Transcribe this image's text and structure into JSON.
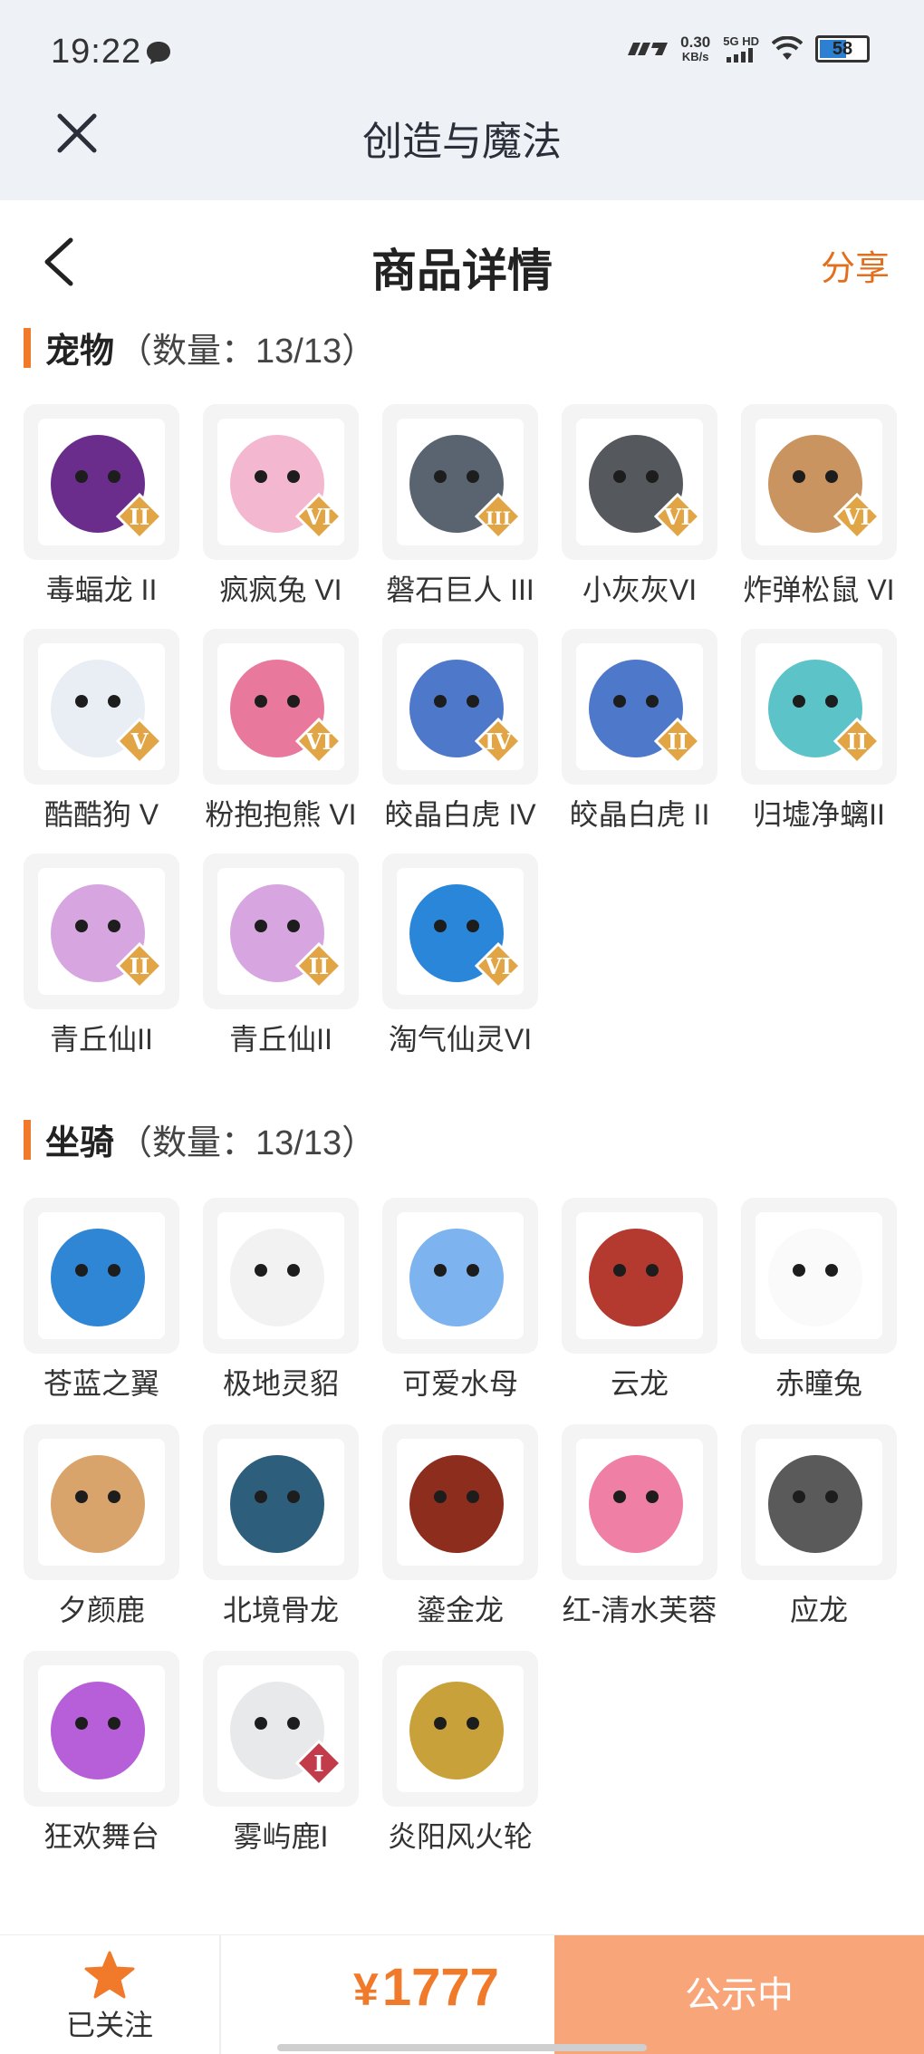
{
  "status_bar": {
    "time": "19:22",
    "net_speed_value": "0.30",
    "net_speed_unit": "KB/s",
    "network_label": "5G HD",
    "battery": "58"
  },
  "app_bar": {
    "title": "创造与魔法"
  },
  "header": {
    "title": "商品详情",
    "share_label": "分享"
  },
  "pets": {
    "name": "宠物",
    "count": "（数量：13/13）",
    "items": [
      {
        "label": "毒蝠龙 II",
        "badge": "II",
        "color": "#6a2d8c"
      },
      {
        "label": "疯疯兔 VI",
        "badge": "VI",
        "color": "#f3b7cf"
      },
      {
        "label": "磐石巨人 III",
        "badge": "III",
        "color": "#5a6470"
      },
      {
        "label": "小灰灰VI",
        "badge": "VI",
        "color": "#55585d"
      },
      {
        "label": "炸弹松鼠 VI",
        "badge": "VI",
        "color": "#c99460"
      },
      {
        "label": "酷酷狗 V",
        "badge": "V",
        "color": "#e9eef5"
      },
      {
        "label": "粉抱抱熊 VI",
        "badge": "VI",
        "color": "#e8799c"
      },
      {
        "label": "皎晶白虎 IV",
        "badge": "IV",
        "color": "#4e78c9"
      },
      {
        "label": "皎晶白虎 II",
        "badge": "II",
        "color": "#4e78c9"
      },
      {
        "label": "归墟净螭II",
        "badge": "II",
        "color": "#5cc4c8"
      },
      {
        "label": "青丘仙II",
        "badge": "II",
        "color": "#d7a6e0"
      },
      {
        "label": "青丘仙II",
        "badge": "II",
        "color": "#d7a6e0"
      },
      {
        "label": "淘气仙灵VI",
        "badge": "VI",
        "color": "#2a86d8"
      }
    ]
  },
  "mounts": {
    "name": "坐骑",
    "count": "（数量：13/13）",
    "items": [
      {
        "label": "苍蓝之翼",
        "color": "#2f86d4"
      },
      {
        "label": "极地灵貂",
        "color": "#f2f2f2"
      },
      {
        "label": "可爱水母",
        "color": "#7db4f0"
      },
      {
        "label": "云龙",
        "color": "#b43a2f"
      },
      {
        "label": "赤瞳兔",
        "color": "#fafafa"
      },
      {
        "label": "夕颜鹿",
        "color": "#d9a46c"
      },
      {
        "label": "北境骨龙",
        "color": "#2d5f7c"
      },
      {
        "label": "鎏金龙",
        "color": "#8d2d1e"
      },
      {
        "label": "红-清水芙蓉",
        "color": "#ef7fa5"
      },
      {
        "label": "应龙",
        "color": "#5a5a5a"
      },
      {
        "label": "狂欢舞台",
        "color": "#b65fd8"
      },
      {
        "label": "雾屿鹿I",
        "badge": "I",
        "color": "#e7e9ea"
      },
      {
        "label": "炎阳风火轮",
        "color": "#c9a13a"
      }
    ]
  },
  "bottom_bar": {
    "follow_label": "已关注",
    "currency": "¥",
    "price": "1777",
    "status_label": "公示中"
  },
  "colors": {
    "accent": "#f07a2a",
    "badge": "#e2a545",
    "mount_badge": "#c23b4a"
  }
}
